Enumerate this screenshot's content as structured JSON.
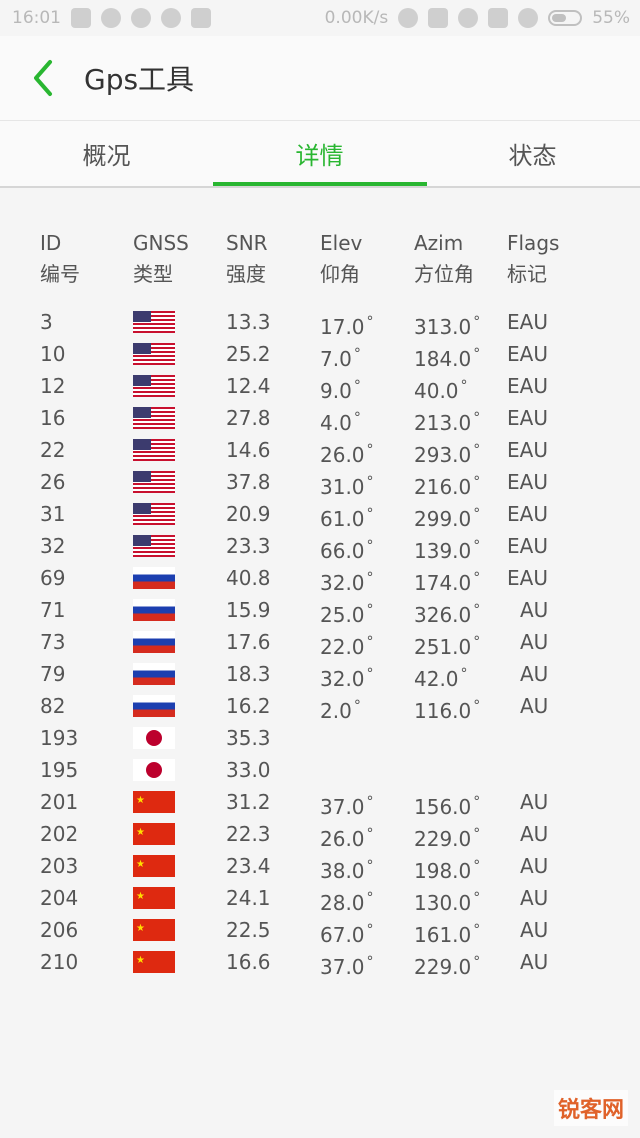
{
  "status_bar": {
    "time": "16:01",
    "speed": "0.00K/s",
    "battery": "55%"
  },
  "app_bar": {
    "title": "Gps工具"
  },
  "tabs": [
    {
      "label": "概况",
      "active": false
    },
    {
      "label": "详情",
      "active": true
    },
    {
      "label": "状态",
      "active": false
    }
  ],
  "table": {
    "headers": [
      {
        "en": "ID",
        "zh": "编号"
      },
      {
        "en": "GNSS",
        "zh": "类型"
      },
      {
        "en": "SNR",
        "zh": "强度"
      },
      {
        "en": "Elev",
        "zh": "仰角"
      },
      {
        "en": "Azim",
        "zh": "方位角"
      },
      {
        "en": "Flags",
        "zh": "标记"
      }
    ],
    "rows": [
      {
        "id": "3",
        "gnss": "us",
        "snr": "13.3",
        "elev": "17.0",
        "azim": "313.0",
        "flags": "EAU"
      },
      {
        "id": "10",
        "gnss": "us",
        "snr": "25.2",
        "elev": "7.0",
        "azim": "184.0",
        "flags": "EAU"
      },
      {
        "id": "12",
        "gnss": "us",
        "snr": "12.4",
        "elev": "9.0",
        "azim": "40.0",
        "flags": "EAU"
      },
      {
        "id": "16",
        "gnss": "us",
        "snr": "27.8",
        "elev": "4.0",
        "azim": "213.0",
        "flags": "EAU"
      },
      {
        "id": "22",
        "gnss": "us",
        "snr": "14.6",
        "elev": "26.0",
        "azim": "293.0",
        "flags": "EAU"
      },
      {
        "id": "26",
        "gnss": "us",
        "snr": "37.8",
        "elev": "31.0",
        "azim": "216.0",
        "flags": "EAU"
      },
      {
        "id": "31",
        "gnss": "us",
        "snr": "20.9",
        "elev": "61.0",
        "azim": "299.0",
        "flags": "EAU"
      },
      {
        "id": "32",
        "gnss": "us",
        "snr": "23.3",
        "elev": "66.0",
        "azim": "139.0",
        "flags": "EAU"
      },
      {
        "id": "69",
        "gnss": "ru",
        "snr": "40.8",
        "elev": "32.0",
        "azim": "174.0",
        "flags": "EAU"
      },
      {
        "id": "71",
        "gnss": "ru",
        "snr": "15.9",
        "elev": "25.0",
        "azim": "326.0",
        "flags": "AU"
      },
      {
        "id": "73",
        "gnss": "ru",
        "snr": "17.6",
        "elev": "22.0",
        "azim": "251.0",
        "flags": "AU"
      },
      {
        "id": "79",
        "gnss": "ru",
        "snr": "18.3",
        "elev": "32.0",
        "azim": "42.0",
        "flags": "AU"
      },
      {
        "id": "82",
        "gnss": "ru",
        "snr": "16.2",
        "elev": "2.0",
        "azim": "116.0",
        "flags": "AU"
      },
      {
        "id": "193",
        "gnss": "jp",
        "snr": "35.3",
        "elev": "",
        "azim": "",
        "flags": ""
      },
      {
        "id": "195",
        "gnss": "jp",
        "snr": "33.0",
        "elev": "",
        "azim": "",
        "flags": ""
      },
      {
        "id": "201",
        "gnss": "cn",
        "snr": "31.2",
        "elev": "37.0",
        "azim": "156.0",
        "flags": "AU"
      },
      {
        "id": "202",
        "gnss": "cn",
        "snr": "22.3",
        "elev": "26.0",
        "azim": "229.0",
        "flags": "AU"
      },
      {
        "id": "203",
        "gnss": "cn",
        "snr": "23.4",
        "elev": "38.0",
        "azim": "198.0",
        "flags": "AU"
      },
      {
        "id": "204",
        "gnss": "cn",
        "snr": "24.1",
        "elev": "28.0",
        "azim": "130.0",
        "flags": "AU"
      },
      {
        "id": "206",
        "gnss": "cn",
        "snr": "22.5",
        "elev": "67.0",
        "azim": "161.0",
        "flags": "AU"
      },
      {
        "id": "210",
        "gnss": "cn",
        "snr": "16.6",
        "elev": "37.0",
        "azim": "229.0",
        "flags": "AU"
      }
    ]
  },
  "watermark": "锐客网",
  "colors": {
    "accent": "#29b631"
  }
}
